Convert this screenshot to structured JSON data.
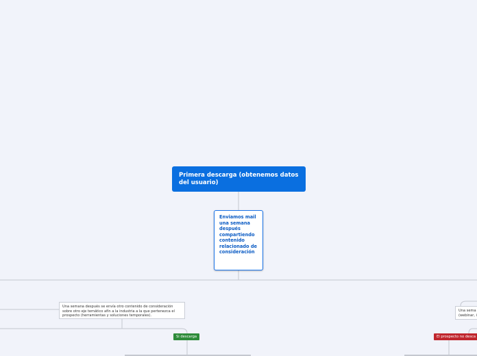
{
  "colors": {
    "background": "#f1f3fa",
    "root": "#0a6fe0",
    "child_border": "#1a73e8",
    "connector": "#c4c7cf",
    "positive": "#2e8b3a",
    "negative": "#c0262d"
  },
  "map": {
    "root": {
      "label": "Primera descarga (obtenemos datos del usuario)"
    },
    "child": {
      "label": "Enviamos mail una semana después compartiendo contenido relacionado de consideración"
    },
    "branches": {
      "left_note": "Una semana después se envía otro contenido de consideración sobre otro eje temático afín a la industria a la que pertenezca el prospecto (herramientas y soluciones temporales).",
      "right_note": "Una sema (webinar, i",
      "yes_tag": "Si descarga",
      "no_tag": "El prospecto no desca"
    }
  }
}
